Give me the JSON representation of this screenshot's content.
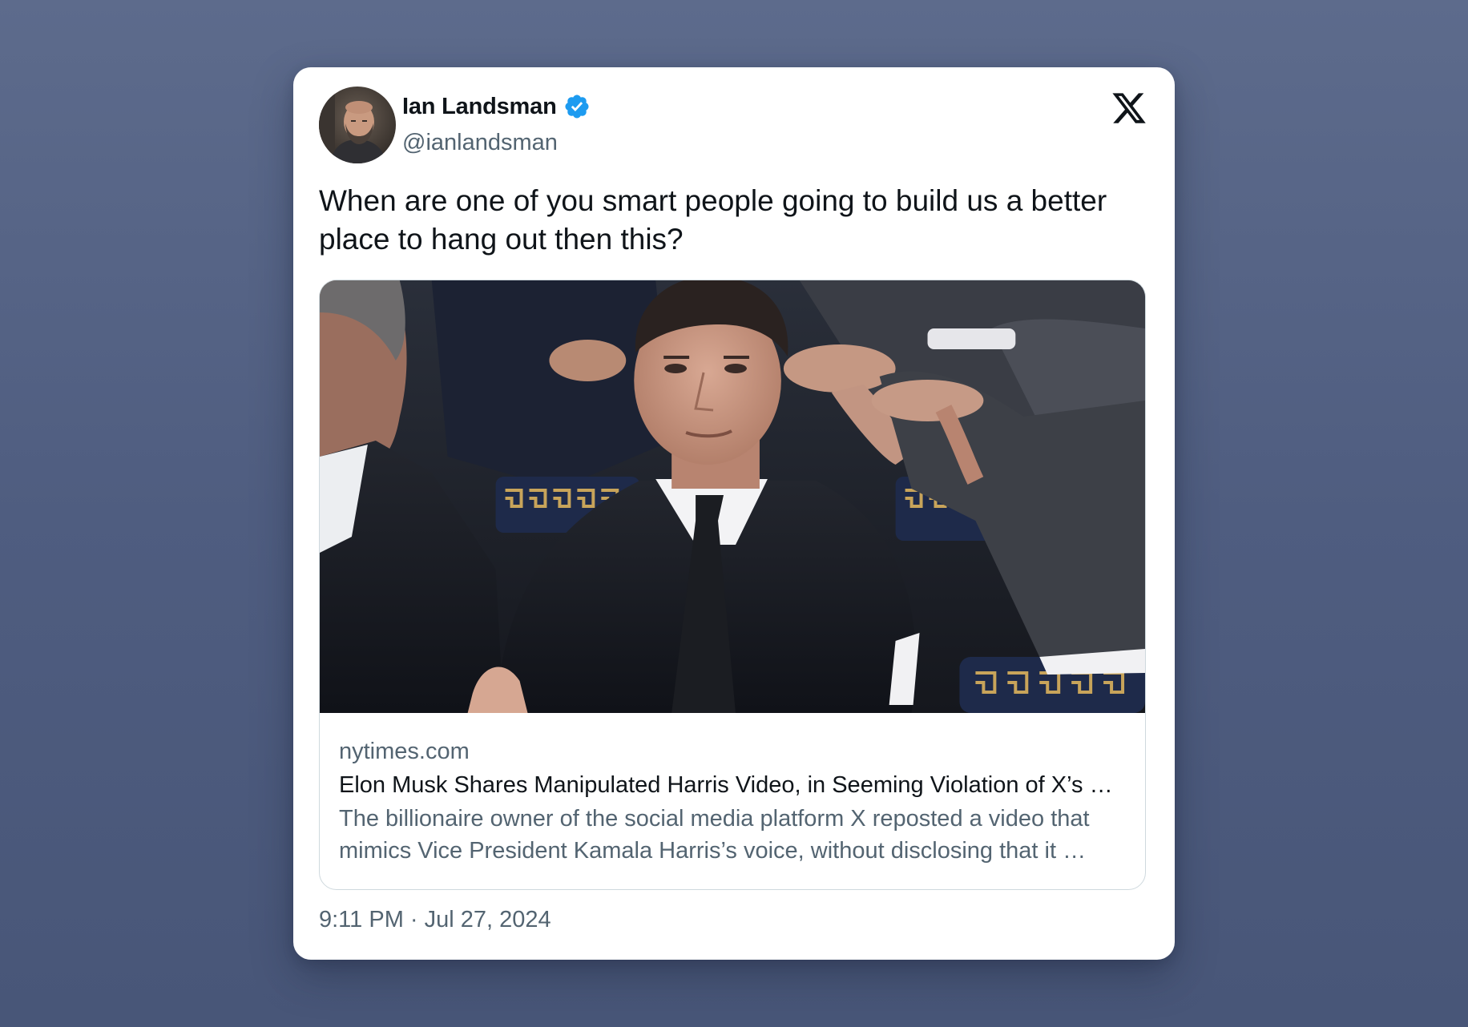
{
  "tweet": {
    "author": {
      "display_name": "Ian Landsman",
      "handle": "@ianlandsman",
      "verified": true,
      "avatar_icon": "profile-photo"
    },
    "platform_icon": "x-logo-icon",
    "text": "When are one of you smart people going to build us a better place to hang out then this?",
    "link_card": {
      "domain": "nytimes.com",
      "title": "Elon Musk Shares Manipulated Harris Video, in Seeming Violation of X’s …",
      "description": "The billionaire owner of the social media platform X reposted a video that mimics Vice President Kamala Harris’s voice, without disclosing that it …"
    },
    "timestamp": "9:11 PM · Jul 27, 2024"
  },
  "colors": {
    "background": "#56648a",
    "card": "#ffffff",
    "primary_text": "#0f1419",
    "secondary_text": "#536471",
    "verified_badge": "#1d9bf0",
    "card_border": "#cfd9de"
  }
}
